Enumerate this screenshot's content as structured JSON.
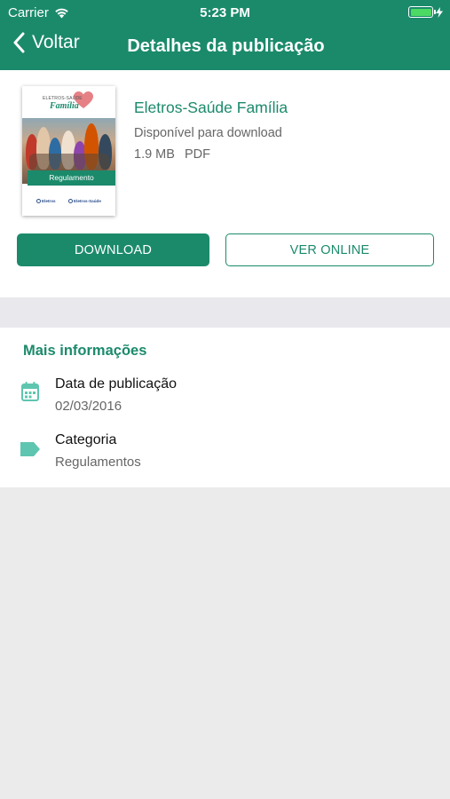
{
  "status_bar": {
    "carrier": "Carrier",
    "time": "5:23 PM",
    "battery_level": 1.0
  },
  "navbar": {
    "back_label": "Voltar",
    "title": "Detalhes da publicação"
  },
  "publication": {
    "cover": {
      "brand_line": "ELETROS-SAÚDE",
      "script_title": "Família",
      "band_label": "Regulamento",
      "logo_left": "Eletros",
      "logo_right": "Eletros-Saúde"
    },
    "title": "Eletros-Saúde Família",
    "status": "Disponível para download",
    "size": "1.9 MB",
    "format": "PDF",
    "download_label": "DOWNLOAD",
    "online_label": "VER ONLINE"
  },
  "more_info": {
    "heading": "Mais informações",
    "rows": [
      {
        "icon": "calendar-icon",
        "label": "Data de publicação",
        "value": "02/03/2016"
      },
      {
        "icon": "tag-icon",
        "label": "Categoria",
        "value": "Regulamentos"
      }
    ]
  },
  "colors": {
    "brand": "#1b8a6b",
    "icon": "#5ec5b0"
  }
}
